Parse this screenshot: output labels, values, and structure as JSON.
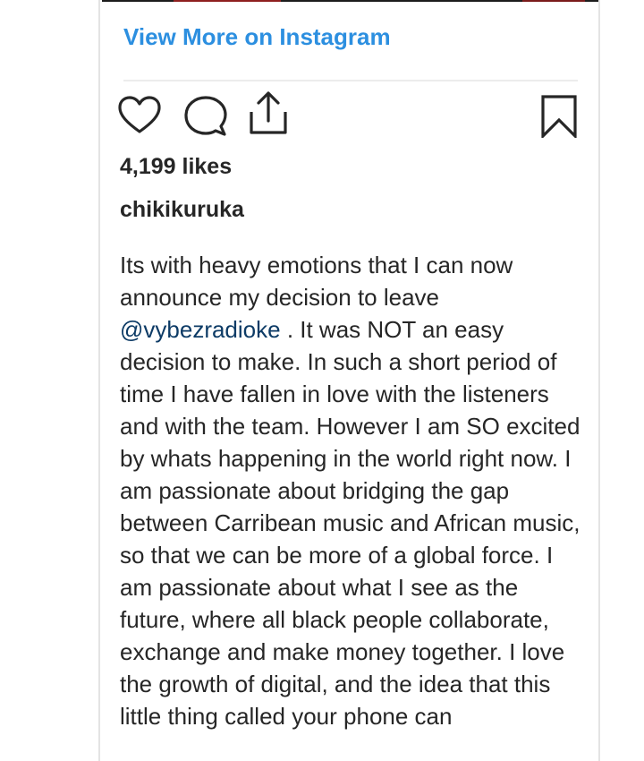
{
  "post": {
    "view_more_label": "View More on Instagram",
    "likes_text": "4,199 likes",
    "username": "chikikuruka",
    "caption_part1": "Its with heavy emotions that I can now announce my decision to leave ",
    "caption_mention": "@vybezradioke",
    "caption_part2": " . It was NOT an easy decision to make. In such a short period of time I have fallen in love with the listeners and with the team. However I am SO excited by whats happening in the world right now. I am passionate about bridging the gap between Carribean music and African music, so that we can be more of a global force. I am passionate about what I see as the future, where all black people collaborate, exchange and make money together. I love the growth of digital, and the idea that this little thing called your phone can"
  },
  "icons": {
    "like": "heart-icon",
    "comment": "comment-bubble-icon",
    "share": "share-upload-icon",
    "save": "bookmark-icon"
  },
  "colors": {
    "link": "#2c8fe0",
    "mention": "#0d3b66",
    "text": "#262626"
  }
}
